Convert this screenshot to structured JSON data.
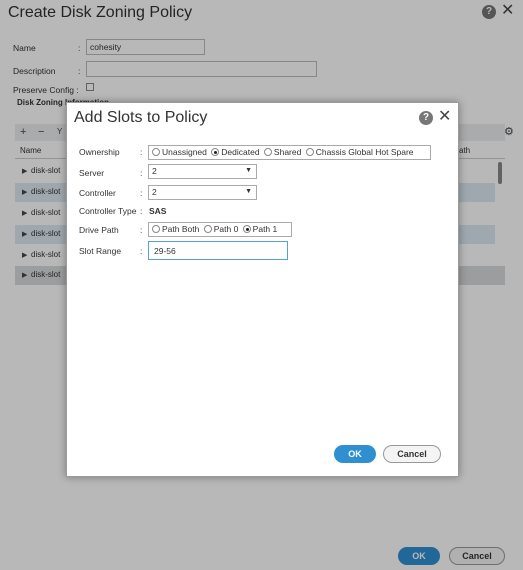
{
  "outer": {
    "title": "Create Disk Zoning Policy",
    "help_icon": "?",
    "close_icon": "✕",
    "fields": {
      "name_label": "Name",
      "name_value": "cohesity",
      "description_label": "Description",
      "description_value": "",
      "preserve_label": "Preserve Config :",
      "colon": ":"
    },
    "section_title": "Disk Zoning Information",
    "toolbar": {
      "add": "+",
      "remove": "−",
      "filter": "Y",
      "settings_icon": "⚙"
    },
    "table": {
      "headers": [
        "Name",
        "ath"
      ],
      "rows": [
        "disk-slot",
        "disk-slot",
        "disk-slot",
        "disk-slot",
        "disk-slot",
        "disk-slot"
      ]
    },
    "ok_label": "OK",
    "cancel_label": "Cancel"
  },
  "modal": {
    "title": "Add Slots to Policy",
    "help_icon": "?",
    "close_icon": "✕",
    "colon": ":",
    "ownership": {
      "label": "Ownership",
      "options": [
        "Unassigned",
        "Dedicated",
        "Shared",
        "Chassis Global Hot Spare"
      ],
      "selected": "Dedicated"
    },
    "server": {
      "label": "Server",
      "value": "2"
    },
    "controller": {
      "label": "Controller",
      "value": "2"
    },
    "controller_type": {
      "label": "Controller Type",
      "value": "SAS"
    },
    "drive_path": {
      "label": "Drive Path",
      "options": [
        "Path Both",
        "Path 0",
        "Path 1"
      ],
      "selected": "Path 1"
    },
    "slot_range": {
      "label": "Slot Range",
      "value": "29-56"
    },
    "ok_label": "OK",
    "cancel_label": "Cancel"
  },
  "colors": {
    "accent": "#2f8fd1",
    "row_alt": "#dde9f3",
    "overlay": "rgba(0,0,0,0.28)"
  }
}
